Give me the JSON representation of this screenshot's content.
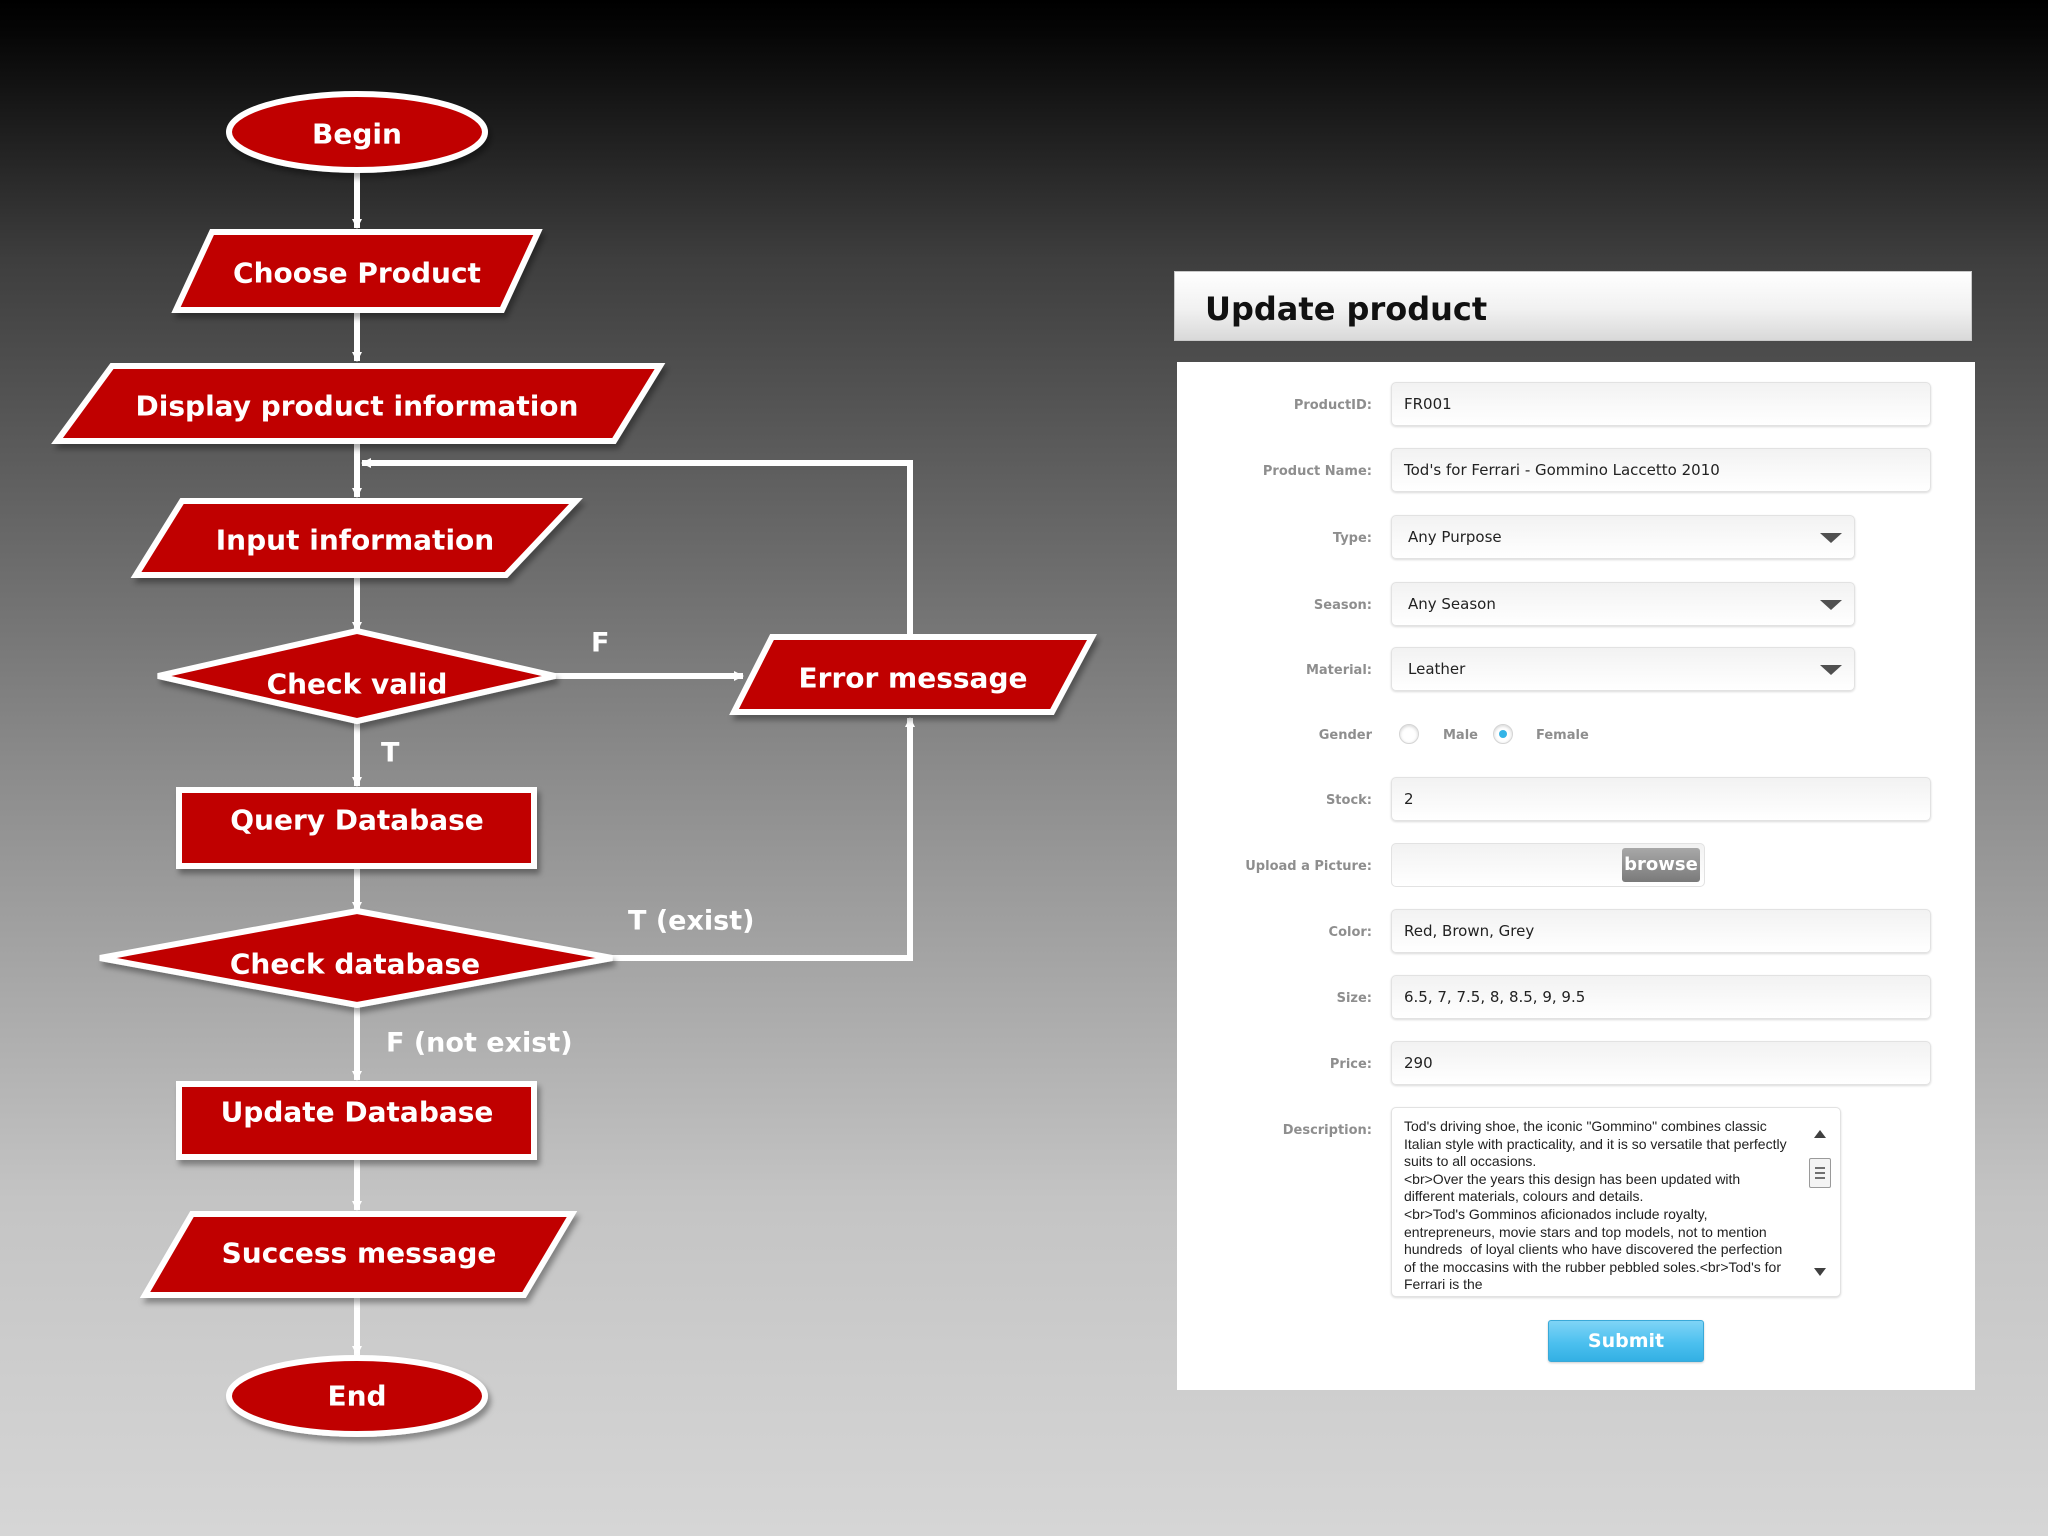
{
  "colors": {
    "node_fill": "#c00000",
    "node_stroke": "#ffffff",
    "connector": "#ffffff",
    "submit_button": "#4cc0ef",
    "radio_selected": "#34b4e7"
  },
  "flowchart": {
    "nodes": {
      "begin": "Begin",
      "choose_product": "Choose Product",
      "display_info": "Display product information",
      "input_info": "Input information",
      "check_valid": "Check valid",
      "error_message": "Error message",
      "query_database": "Query Database",
      "check_database": "Check database",
      "update_database": "Update Database",
      "success_message": "Success message",
      "end": "End"
    },
    "edge_labels": {
      "valid_false": "F",
      "valid_true": "T",
      "db_exist": "T (exist)",
      "db_not_exist": "F (not exist)"
    }
  },
  "form": {
    "title": "Update product",
    "fields": {
      "product_id": {
        "label": "ProductID:",
        "value": "FR001"
      },
      "product_name": {
        "label": "Product Name:",
        "value": "Tod's for Ferrari - Gommino Laccetto 2010"
      },
      "type": {
        "label": "Type:",
        "value": "Any Purpose"
      },
      "season": {
        "label": "Season:",
        "value": "Any Season"
      },
      "material": {
        "label": "Material:",
        "value": "Leather"
      },
      "gender": {
        "label": "Gender",
        "options": [
          "Male",
          "Female"
        ],
        "selected": "Female"
      },
      "stock": {
        "label": "Stock:",
        "value": "2"
      },
      "picture": {
        "label": "Upload a Picture:",
        "button": "browse"
      },
      "color": {
        "label": "Color:",
        "value": "Red, Brown, Grey"
      },
      "size": {
        "label": "Size:",
        "value": "6.5, 7, 7.5, 8, 8.5, 9, 9.5"
      },
      "price": {
        "label": "Price:",
        "value": "290"
      },
      "description": {
        "label": "Description:",
        "value": "Tod's driving shoe, the iconic \"Gommino\" combines classic Italian style with practicality, and it is so versatile that perfectly suits to all occasions.\n<br>Over the years this design has been updated with different materials, colours and details.\n<br>Tod's Gomminos aficionados include royalty, entrepreneurs, movie stars and top models, not to mention hundreds  of loyal clients who have discovered the perfection of the moccasins with the rubber pebbled soles.<br>Tod's for Ferrari is the"
      }
    },
    "submit_label": "Submit"
  }
}
